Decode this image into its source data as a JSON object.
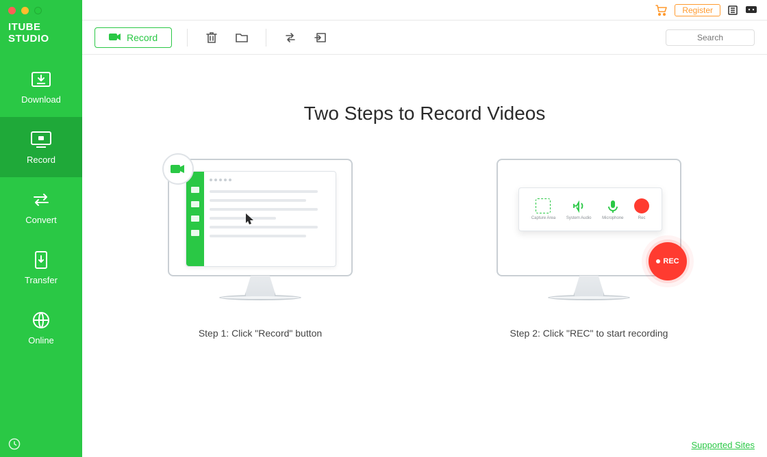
{
  "app_name": "ITUBE STUDIO",
  "sidebar": {
    "items": [
      {
        "label": "Download",
        "icon": "download-icon"
      },
      {
        "label": "Record",
        "icon": "record-screen-icon"
      },
      {
        "label": "Convert",
        "icon": "convert-icon"
      },
      {
        "label": "Transfer",
        "icon": "transfer-icon"
      },
      {
        "label": "Online",
        "icon": "globe-icon"
      }
    ],
    "active_index": 1
  },
  "topbar": {
    "register_label": "Register"
  },
  "toolbar": {
    "record_label": "Record",
    "search_placeholder": "Search"
  },
  "content": {
    "title": "Two Steps to Record Videos",
    "step1_caption": "Step 1: Click \"Record\" button",
    "step2_caption": "Step 2: Click \"REC\" to start recording",
    "step2_options": [
      "Capture Area",
      "System Audio",
      "Microphone",
      "Rec"
    ],
    "rec_badge": "REC"
  },
  "footer": {
    "supported_sites_label": "Supported Sites"
  },
  "colors": {
    "accent": "#2ac845",
    "register": "#ff9a2e",
    "rec": "#ff3b30"
  }
}
